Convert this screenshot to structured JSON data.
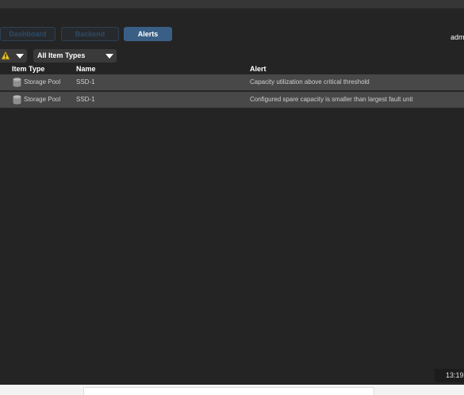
{
  "nav": {
    "tabs": [
      {
        "label": "Dashboard",
        "active": false
      },
      {
        "label": "Backend",
        "active": false
      },
      {
        "label": "Alerts",
        "active": true
      }
    ]
  },
  "header": {
    "user_label": "admin"
  },
  "filters": {
    "severity_icon": "warning-icon",
    "item_type": "All Item Types"
  },
  "table": {
    "columns": [
      "Item Type",
      "Name",
      "Alert"
    ],
    "rows": [
      {
        "item_type": "Storage Pool",
        "name": "SSD-1",
        "alert": "Capacity utilization above critical threshold"
      },
      {
        "item_type": "Storage Pool",
        "name": "SSD-1",
        "alert": "Configured spare capacity is smaller than largest fault unit"
      }
    ]
  },
  "footer": {
    "time": "13:19"
  },
  "colors": {
    "background": "#242424",
    "row": "#484848",
    "accent": "#3a5f86",
    "warning": "#e8c62c"
  }
}
